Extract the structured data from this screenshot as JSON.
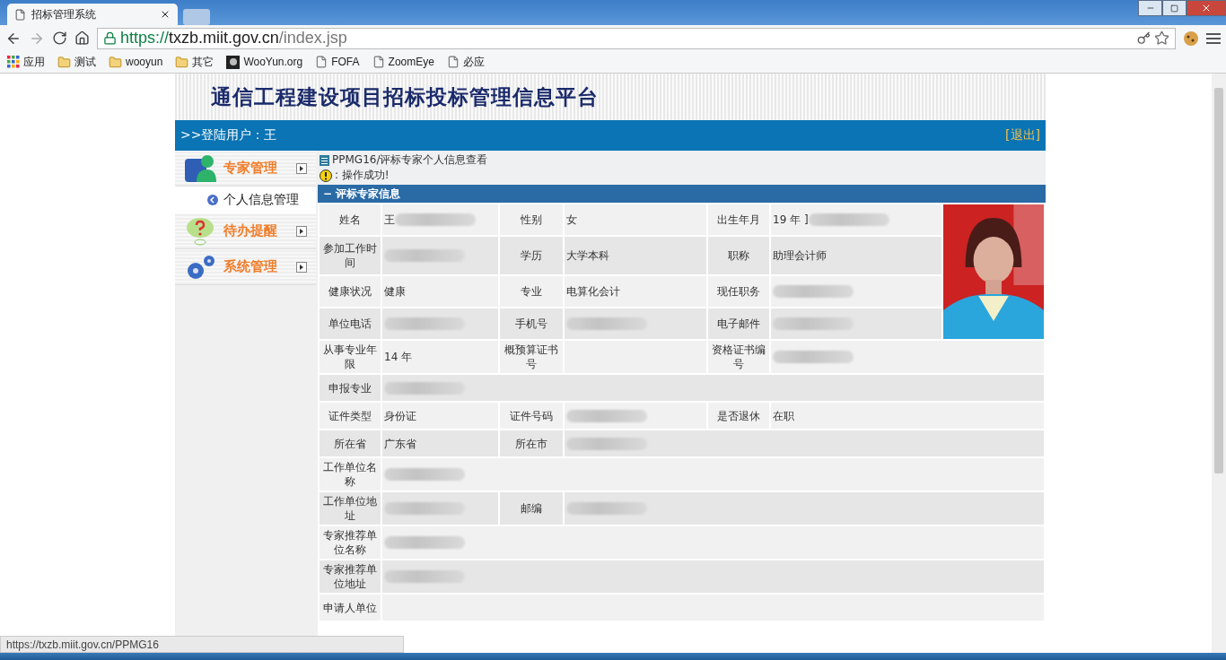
{
  "browser": {
    "tab_title": "招标管理系统",
    "url": {
      "scheme": "https://",
      "host": "txzb.miit.gov.cn",
      "path": "/index.jsp"
    },
    "bookmarks": [
      {
        "kind": "apps",
        "label": "应用"
      },
      {
        "kind": "folder",
        "label": "测试"
      },
      {
        "kind": "folder",
        "label": "wooyun"
      },
      {
        "kind": "folder",
        "label": "其它"
      },
      {
        "kind": "site",
        "label": "WooYun.org"
      },
      {
        "kind": "page",
        "label": "FOFA"
      },
      {
        "kind": "page",
        "label": "ZoomEye"
      },
      {
        "kind": "page",
        "label": "必应"
      }
    ],
    "status_url": "https://txzb.miit.gov.cn/PPMG16"
  },
  "header": {
    "title": "通信工程建设项目招标投标管理信息平台"
  },
  "user_bar": {
    "user": ">>登陆用户：王",
    "logout": "[退出]"
  },
  "sidebar": [
    {
      "kind": "menu",
      "label": "专家管理",
      "selected": false
    },
    {
      "kind": "sub",
      "label": "个人信息管理",
      "selected": true
    },
    {
      "kind": "menu",
      "label": "待办提醒",
      "selected": false
    },
    {
      "kind": "menu",
      "label": "系统管理",
      "selected": false
    }
  ],
  "breadcrumb": "PPMG16/评标专家个人信息查看",
  "message": ": 操作成功!",
  "section": {
    "toggle": "−",
    "title": "评标专家信息"
  },
  "rows": [
    {
      "cells": [
        {
          "kind": "label",
          "text": "姓名"
        },
        {
          "kind": "value",
          "text": "王",
          "redacted": true
        },
        {
          "kind": "label",
          "text": "性别"
        },
        {
          "kind": "value",
          "text": "女",
          "redacted": false
        },
        {
          "kind": "label",
          "text": "出生年月"
        },
        {
          "kind": "value",
          "text": "19 年 ]",
          "redacted": true
        }
      ]
    },
    {
      "cells": [
        {
          "kind": "label",
          "text": "参加工作时间"
        },
        {
          "kind": "value",
          "redacted": true
        },
        {
          "kind": "label",
          "text": "学历"
        },
        {
          "kind": "value",
          "text": "大学本科",
          "redacted": false
        },
        {
          "kind": "label",
          "text": "职称"
        },
        {
          "kind": "value",
          "text": "助理会计师",
          "redacted": false
        }
      ]
    },
    {
      "cells": [
        {
          "kind": "label",
          "text": "健康状况"
        },
        {
          "kind": "value",
          "text": "健康",
          "redacted": false
        },
        {
          "kind": "label",
          "text": "专业"
        },
        {
          "kind": "value",
          "text": "电算化会计",
          "redacted": false
        },
        {
          "kind": "label",
          "text": "现任职务"
        },
        {
          "kind": "value",
          "redacted": true
        }
      ]
    },
    {
      "cells": [
        {
          "kind": "label",
          "text": "单位电话"
        },
        {
          "kind": "value",
          "redacted": true
        },
        {
          "kind": "label",
          "text": "手机号"
        },
        {
          "kind": "value",
          "redacted": true
        },
        {
          "kind": "label",
          "text": "电子邮件"
        },
        {
          "kind": "value",
          "redacted": true
        }
      ]
    },
    {
      "cells": [
        {
          "kind": "label",
          "text": "从事专业年限"
        },
        {
          "kind": "value",
          "text": "14 年",
          "redacted": false
        },
        {
          "kind": "label",
          "text": "概预算证书号"
        },
        {
          "kind": "value",
          "redacted": false
        },
        {
          "kind": "label",
          "text": "资格证书编号"
        },
        {
          "kind": "value",
          "redacted": true
        }
      ]
    },
    {
      "cells": [
        {
          "kind": "label",
          "text": "申报专业"
        },
        {
          "kind": "value",
          "redacted": true
        }
      ]
    },
    {
      "cells": [
        {
          "kind": "label",
          "text": "证件类型"
        },
        {
          "kind": "value",
          "text": "身份证",
          "redacted": false
        },
        {
          "kind": "label",
          "text": "证件号码"
        },
        {
          "kind": "value",
          "redacted": true
        },
        {
          "kind": "label",
          "text": "是否退休"
        },
        {
          "kind": "value",
          "text": "在职",
          "redacted": false
        }
      ]
    },
    {
      "cells": [
        {
          "kind": "label",
          "text": "所在省"
        },
        {
          "kind": "value",
          "text": "广东省",
          "redacted": false
        },
        {
          "kind": "label",
          "text": "所在市"
        },
        {
          "kind": "value",
          "redacted": true
        }
      ]
    },
    {
      "cells": [
        {
          "kind": "label",
          "text": "工作单位名称"
        },
        {
          "kind": "value",
          "redacted": true
        }
      ]
    },
    {
      "cells": [
        {
          "kind": "label",
          "text": "工作单位地址"
        },
        {
          "kind": "value",
          "redacted": true
        },
        {
          "kind": "label",
          "text": "邮编"
        },
        {
          "kind": "value",
          "redacted": true
        }
      ]
    },
    {
      "cells": [
        {
          "kind": "label",
          "text": "专家推荐单位名称"
        },
        {
          "kind": "value",
          "redacted": true
        }
      ]
    },
    {
      "cells": [
        {
          "kind": "label",
          "text": "专家推荐单位地址"
        },
        {
          "kind": "value",
          "redacted": true
        }
      ]
    },
    {
      "cells": [
        {
          "kind": "label",
          "text": "申请人单位"
        },
        {
          "kind": "value",
          "redacted": false
        }
      ]
    }
  ]
}
